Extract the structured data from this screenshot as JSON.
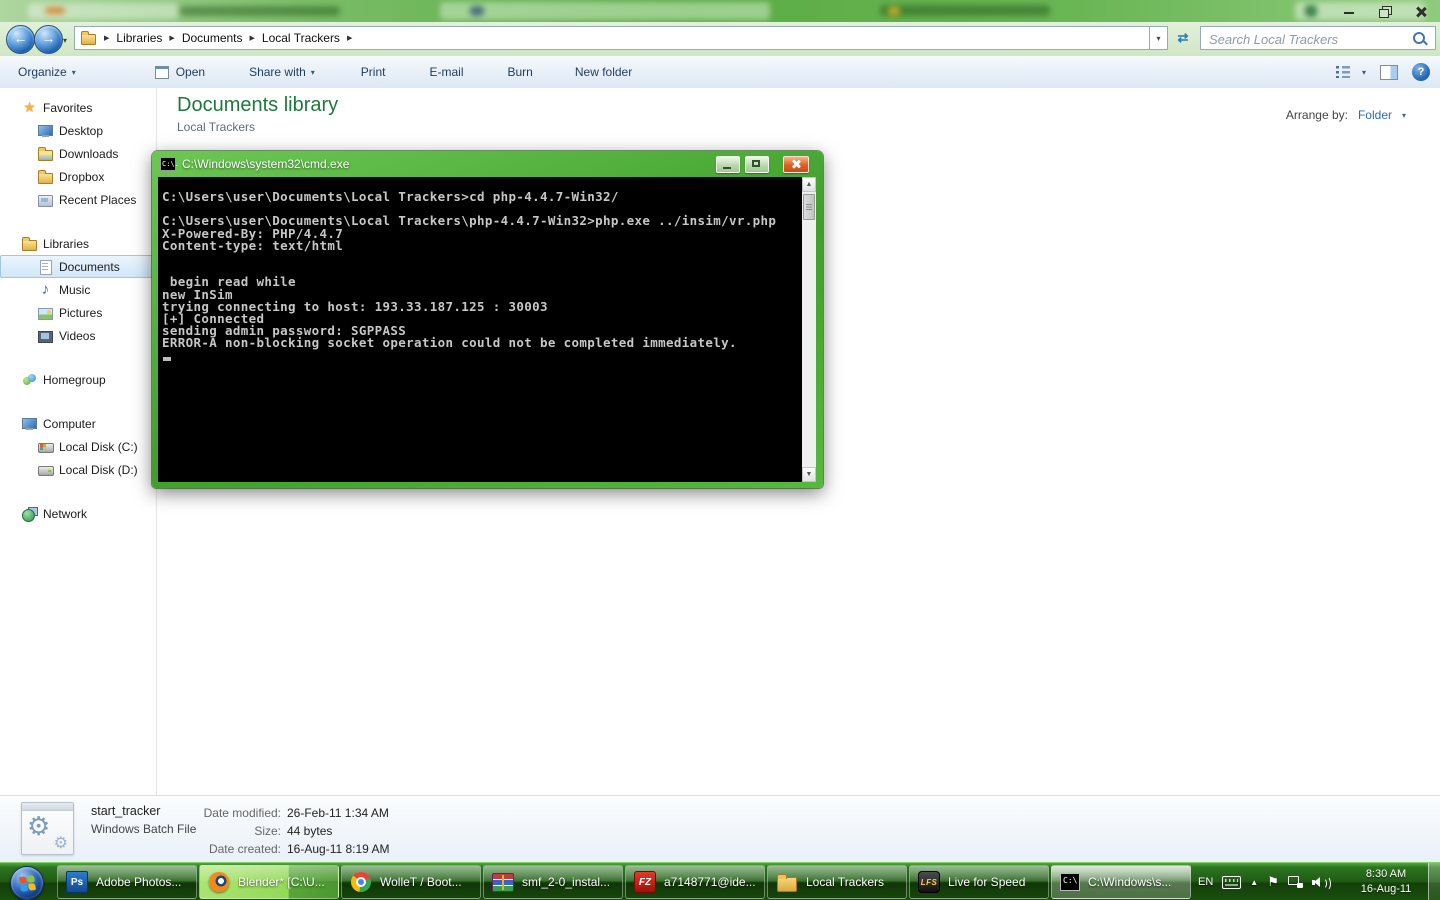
{
  "address_bar": {
    "breadcrumb_items": [
      "Libraries",
      "Documents",
      "Local Trackers"
    ],
    "separator_glyph": "▶",
    "dropdown_glyph": "▾",
    "back_glyph": "←",
    "forward_glyph": "→",
    "refresh_glyph": "⇄",
    "search_placeholder": "Search Local Trackers"
  },
  "toolbar": {
    "items": [
      {
        "label": "Organize",
        "arrow": true,
        "icon": false
      },
      {
        "label": "Open",
        "arrow": false,
        "icon": true
      },
      {
        "label": "Share with",
        "arrow": true,
        "icon": false
      },
      {
        "label": "Print",
        "arrow": false,
        "icon": false
      },
      {
        "label": "E-mail",
        "arrow": false,
        "icon": false
      },
      {
        "label": "Burn",
        "arrow": false,
        "icon": false
      },
      {
        "label": "New folder",
        "arrow": false,
        "icon": false
      }
    ],
    "arrow_glyph": "▾",
    "help_glyph": "?"
  },
  "sidebar": {
    "sections": [
      {
        "label": "Favorites",
        "icon": "favorites-star-icon",
        "items": [
          {
            "label": "Desktop",
            "icon": "desktop-icon"
          },
          {
            "label": "Downloads",
            "icon": "downloads-icon"
          },
          {
            "label": "Dropbox",
            "icon": "dropbox-folder-icon"
          },
          {
            "label": "Recent Places",
            "icon": "recent-places-icon"
          }
        ]
      },
      {
        "label": "Libraries",
        "icon": "libraries-icon",
        "items": [
          {
            "label": "Documents",
            "icon": "documents-icon",
            "selected": true
          },
          {
            "label": "Music",
            "icon": "music-icon"
          },
          {
            "label": "Pictures",
            "icon": "pictures-icon"
          },
          {
            "label": "Videos",
            "icon": "videos-icon"
          }
        ]
      },
      {
        "label": "Homegroup",
        "icon": "homegroup-icon",
        "items": []
      },
      {
        "label": "Computer",
        "icon": "computer-icon",
        "items": [
          {
            "label": "Local Disk (C:)",
            "icon": "disk-c-icon"
          },
          {
            "label": "Local Disk (D:)",
            "icon": "disk-icon"
          }
        ]
      },
      {
        "label": "Network",
        "icon": "network-icon",
        "items": []
      }
    ]
  },
  "icon_glyphs": {
    "favorites-star-icon": "★",
    "music-icon": "♪"
  },
  "content_header": {
    "title": "Documents library",
    "subtitle": "Local Trackers",
    "arrange_by_label": "Arrange by:",
    "arrange_by_value": "Folder",
    "arrange_arrow_glyph": "▾"
  },
  "cmd_window": {
    "title": "C:\\Windows\\system32\\cmd.exe",
    "icon_text": "C:\\.",
    "scroll_up_glyph": "▲",
    "scroll_down_glyph": "▼",
    "console_lines": [
      "C:\\Users\\user\\Documents\\Local Trackers>cd php-4.4.7-Win32/",
      "",
      "C:\\Users\\user\\Documents\\Local Trackers\\php-4.4.7-Win32>php.exe ../insim/vr.php",
      "X-Powered-By: PHP/4.4.7",
      "Content-type: text/html",
      "",
      "",
      " begin read while",
      "new InSim",
      "trying connecting to host: 193.33.187.125 : 30003",
      "[+] Connected",
      "sending admin password: SGPPASS",
      "ERROR-A non-blocking socket operation could not be completed immediately."
    ]
  },
  "details_pane": {
    "file_name": "start_tracker",
    "file_type": "Windows Batch File",
    "gear_glyph": "⚙",
    "fields": [
      {
        "label": "Date modified:",
        "value": "26-Feb-11 1:34 AM"
      },
      {
        "label": "Size:",
        "value": "44 bytes"
      },
      {
        "label": "Date created:",
        "value": "16-Aug-11 8:19 AM"
      }
    ]
  },
  "taskbar": {
    "buttons": [
      {
        "label": "Adobe Photos...",
        "icon": "photoshop-icon",
        "icon_text": "Ps",
        "state": "normal"
      },
      {
        "label": "Blender* [C:\\U...",
        "icon": "blender-icon",
        "icon_text": "",
        "state": "progress"
      },
      {
        "label": "WolleT / Boot...",
        "icon": "chrome-icon",
        "icon_text": "",
        "state": "normal"
      },
      {
        "label": "smf_2-0_instal...",
        "icon": "winrar-icon",
        "icon_text": "",
        "state": "normal"
      },
      {
        "label": "a7148771@ide...",
        "icon": "filezilla-icon",
        "icon_text": "FZ",
        "state": "normal"
      },
      {
        "label": "Local Trackers",
        "icon": "folder-icon",
        "icon_text": "",
        "state": "normal"
      },
      {
        "label": "Live for Speed",
        "icon": "lfs-icon",
        "icon_text": "LFS",
        "state": "normal"
      },
      {
        "label": "C:\\Windows\\s...",
        "icon": "cmd-icon",
        "icon_text": "C:\\",
        "state": "active"
      }
    ],
    "tray": {
      "language": "EN",
      "expand_glyph": "▲",
      "flag_glyph": "⚑",
      "time": "8:30 AM",
      "date": "16-Aug-11"
    }
  }
}
